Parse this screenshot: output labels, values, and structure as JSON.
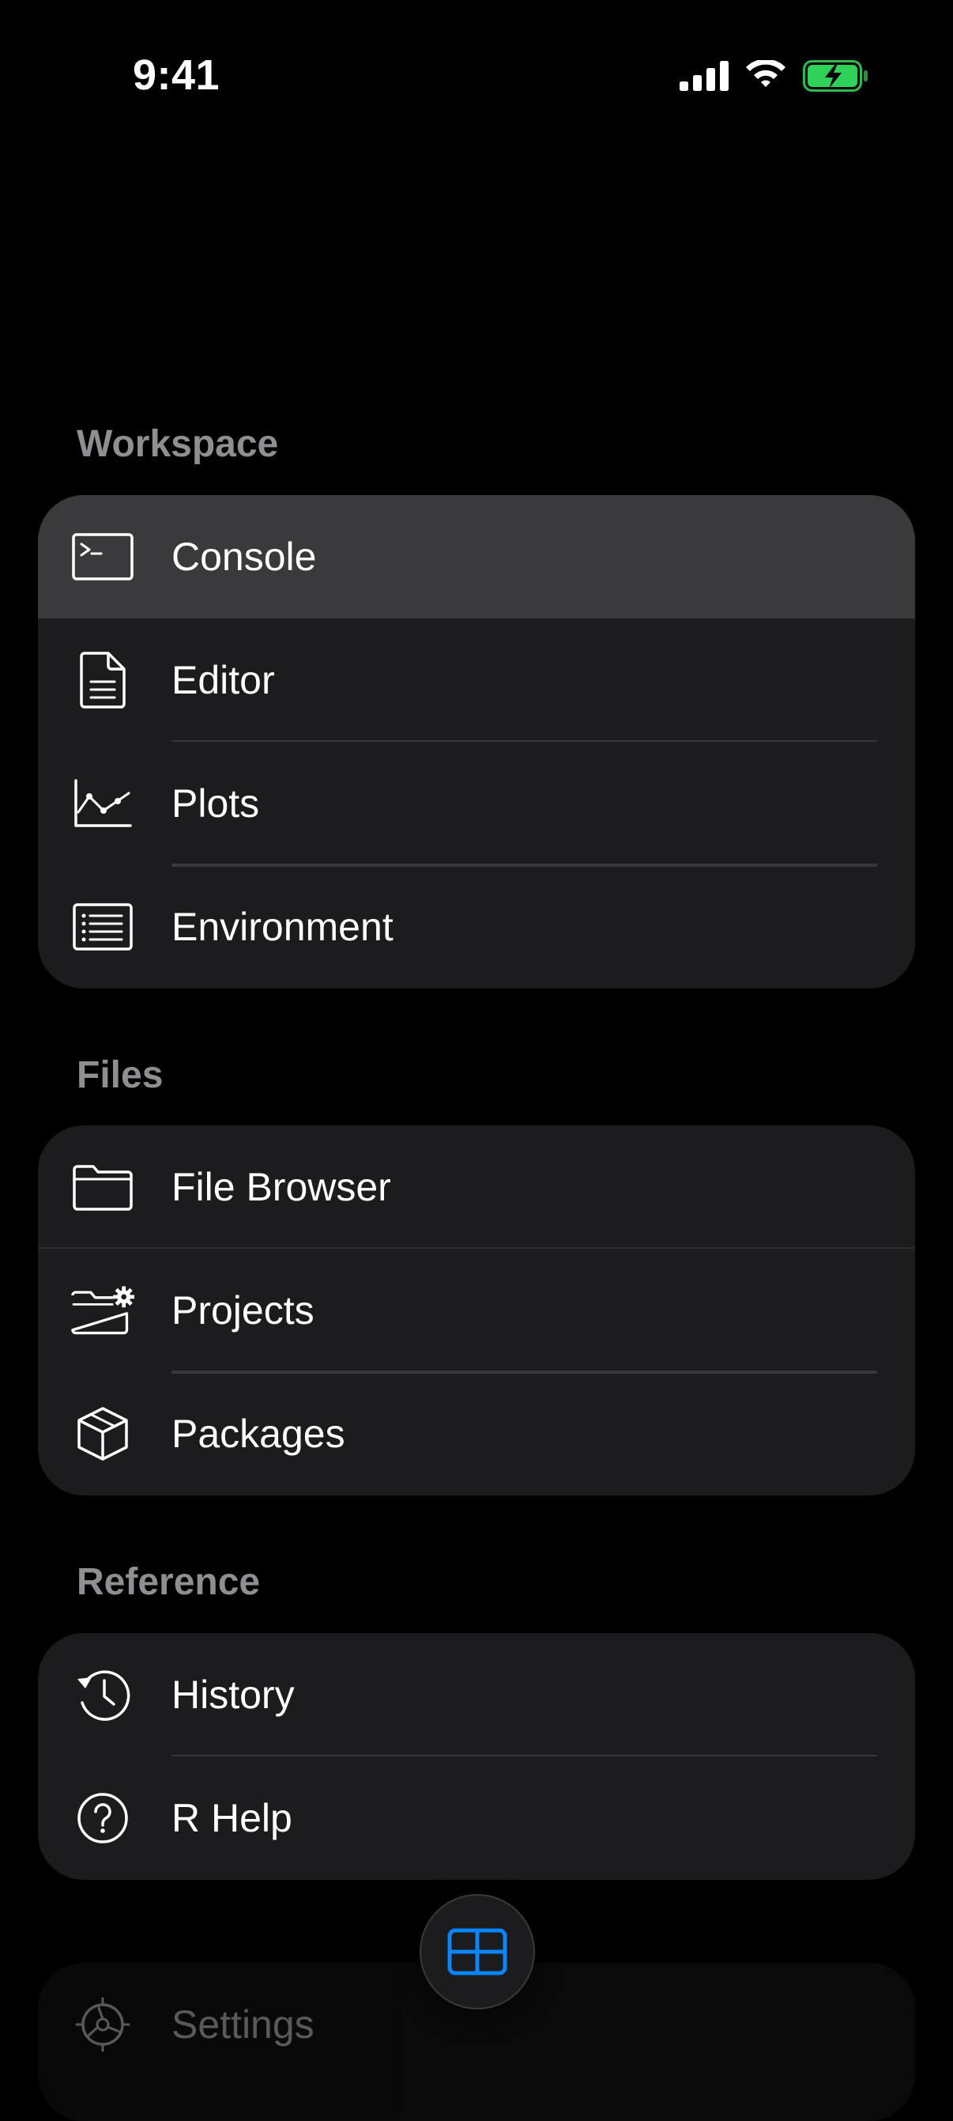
{
  "status_bar": {
    "time": "9:41"
  },
  "sections": {
    "workspace": {
      "title": "Workspace",
      "items": [
        {
          "label": "Console",
          "icon": "terminal-icon"
        },
        {
          "label": "Editor",
          "icon": "document-icon"
        },
        {
          "label": "Plots",
          "icon": "line-chart-icon"
        },
        {
          "label": "Environment",
          "icon": "list-icon"
        }
      ]
    },
    "files": {
      "title": "Files",
      "items": [
        {
          "label": "File Browser",
          "icon": "folder-icon"
        },
        {
          "label": "Projects",
          "icon": "folder-gear-icon"
        },
        {
          "label": "Packages",
          "icon": "package-icon"
        }
      ]
    },
    "reference": {
      "title": "Reference",
      "items": [
        {
          "label": "History",
          "icon": "history-icon"
        },
        {
          "label": "R Help",
          "icon": "help-icon"
        }
      ]
    },
    "settings": {
      "items": [
        {
          "label": "Settings",
          "icon": "gear-icon"
        }
      ]
    }
  },
  "selected_item": "Console",
  "colors": {
    "accent": "#0a84ff",
    "battery": "#30d158",
    "card": "#1c1c1e",
    "selected_row": "#3a3a3c",
    "section_title": "#8e8e93"
  },
  "fab": {
    "icon": "grid-icon"
  }
}
